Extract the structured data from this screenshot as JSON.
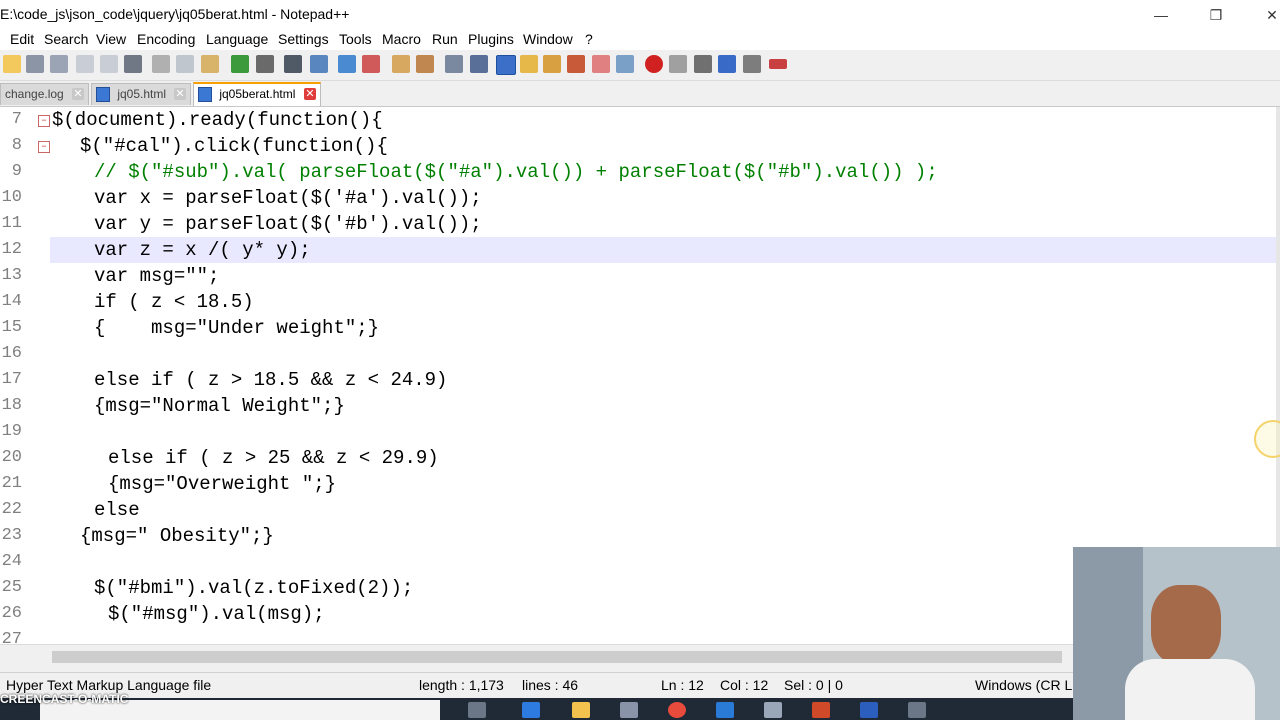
{
  "window": {
    "title": "E:\\code_js\\json_code\\jquery\\jq05berat.html - Notepad++",
    "minimize_glyph": "—",
    "maximize_glyph": "❐",
    "close_glyph": "✕"
  },
  "menu": [
    "Edit",
    "Search",
    "View",
    "Encoding",
    "Language",
    "Settings",
    "Tools",
    "Macro",
    "Run",
    "Plugins",
    "Window",
    "?"
  ],
  "tabs": [
    {
      "label": "change.log",
      "active": false
    },
    {
      "label": "jq05.html",
      "active": false
    },
    {
      "label": "jq05berat.html",
      "active": true
    }
  ],
  "editor": {
    "current_line": 12,
    "lines": [
      {
        "num": "7",
        "text": "$(document).ready(function(){"
      },
      {
        "num": "8",
        "text": "$(\"#cal\").click(function(){"
      },
      {
        "num": "9",
        "text": "// $(\"#sub\").val( parseFloat($(\"#a\").val()) + parseFloat($(\"#b\").val()) );"
      },
      {
        "num": "10",
        "text": "var x = parseFloat($('#a').val());"
      },
      {
        "num": "11",
        "text": "var y = parseFloat($('#b').val());"
      },
      {
        "num": "12",
        "text": "var z = x /( y* y);"
      },
      {
        "num": "13",
        "text": "var msg=\"\";"
      },
      {
        "num": "14",
        "text": "if ( z < 18.5)"
      },
      {
        "num": "15",
        "text": "{    msg=\"Under weight\";}"
      },
      {
        "num": "16",
        "text": ""
      },
      {
        "num": "17",
        "text": "else if ( z > 18.5 && z < 24.9)"
      },
      {
        "num": "18",
        "text": "{msg=\"Normal Weight\";}"
      },
      {
        "num": "19",
        "text": ""
      },
      {
        "num": "20",
        "text": "else if ( z > 25 && z < 29.9)"
      },
      {
        "num": "21",
        "text": "{msg=\"Overweight \";}"
      },
      {
        "num": "22",
        "text": "else"
      },
      {
        "num": "23",
        "text": "{msg=\" Obesity\";}"
      },
      {
        "num": "24",
        "text": ""
      },
      {
        "num": "25",
        "text": "$(\"#bmi\").val(z.toFixed(2));"
      },
      {
        "num": "26",
        "text": "$(\"#msg\").val(msg);"
      },
      {
        "num": "27",
        "text": ""
      }
    ]
  },
  "status": {
    "file_type": "Hyper Text Markup Language file",
    "length": "length : 1,173",
    "lines": "lines : 46",
    "ln": "Ln : 12",
    "col": "Col : 12",
    "sel": "Sel : 0 | 0",
    "eol": "Windows (CR LF)"
  },
  "watermark": "CREENCAST-O-MATIC",
  "colors": {
    "keyword": "#000080",
    "string": "#808080",
    "number": "#ff0000",
    "comment": "#008000",
    "current_line": "#e8e8ff"
  }
}
